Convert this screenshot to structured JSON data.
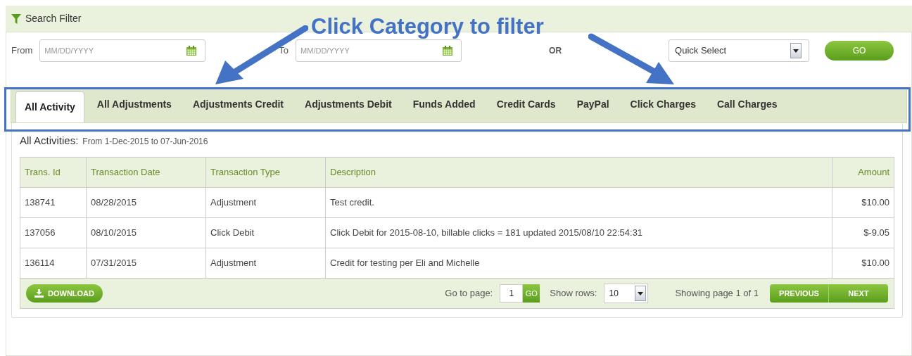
{
  "search_filter": {
    "title": "Search Filter",
    "from_label": "From",
    "from_placeholder": "MM/DD/YYYY",
    "to_label": "To",
    "to_placeholder": "MM/DD/YYYY",
    "or_label": "OR",
    "quick_select": "Quick Select",
    "go": "GO"
  },
  "annotation": {
    "text": "Click Category to filter"
  },
  "tabs": [
    {
      "label": "All Activity",
      "selected": true
    },
    {
      "label": "All Adjustments",
      "selected": false
    },
    {
      "label": "Adjustments Credit",
      "selected": false
    },
    {
      "label": "Adjustments Debit",
      "selected": false
    },
    {
      "label": "Funds Added",
      "selected": false
    },
    {
      "label": "Credit Cards",
      "selected": false
    },
    {
      "label": "PayPal",
      "selected": false
    },
    {
      "label": "Click Charges",
      "selected": false
    },
    {
      "label": "Call Charges",
      "selected": false
    }
  ],
  "summary": {
    "title": "All Activities:",
    "range": "From 1-Dec-2015 to 07-Jun-2016"
  },
  "table": {
    "columns": [
      "Trans. Id",
      "Transaction Date",
      "Transaction Type",
      "Description",
      "Amount"
    ],
    "rows": [
      [
        "138741",
        "08/28/2015",
        "Adjustment",
        "Test credit.",
        "$10.00"
      ],
      [
        "137056",
        "08/10/2015",
        "Click Debit",
        "Click Debit for 2015-08-10, billable clicks = 181 updated 2015/08/10 22:54:31",
        "$-9.05"
      ],
      [
        "136114",
        "07/31/2015",
        "Adjustment",
        "Credit for testing per Eli and Michelle",
        "$10.00"
      ]
    ]
  },
  "footer": {
    "download": "DOWNLOAD",
    "go_to_page_label": "Go to page:",
    "page_value": "1",
    "go": "GO",
    "show_rows_label": "Show rows:",
    "rows_value": "10",
    "showing": "Showing page 1 of 1",
    "previous": "PREVIOUS",
    "next": "NEXT"
  }
}
